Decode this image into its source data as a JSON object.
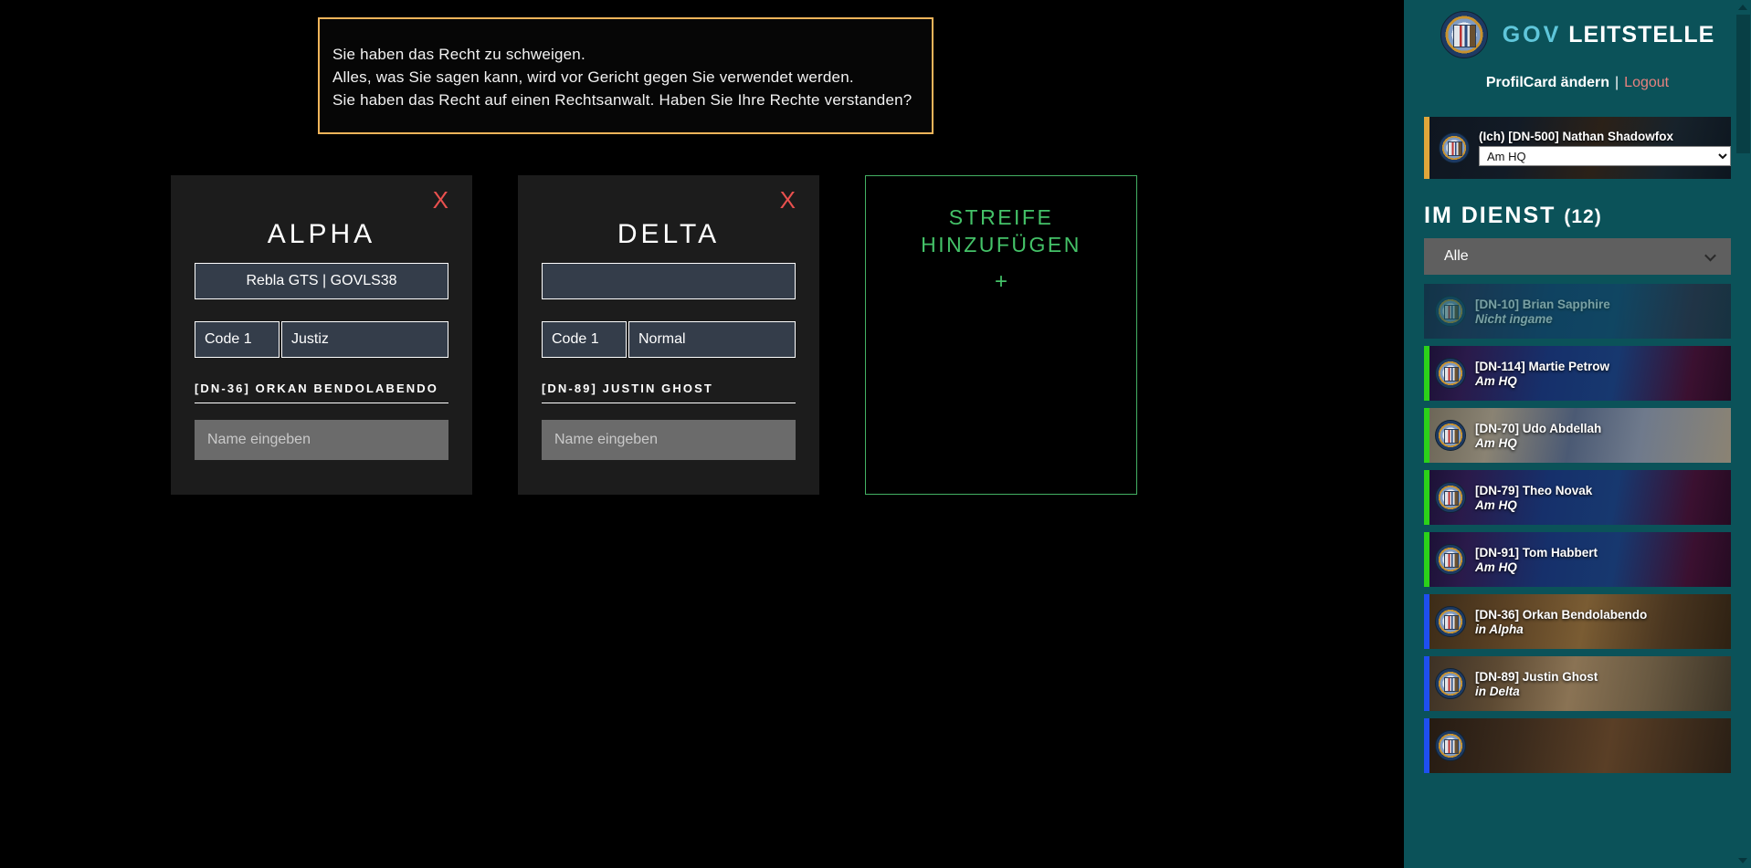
{
  "miranda": {
    "lines": [
      "Sie haben das Recht zu schweigen.",
      "Alles, was Sie sagen kann, wird vor Gericht gegen Sie verwendet werden.",
      "Sie haben das Recht auf einen Rechtsanwalt. Haben Sie Ihre Rechte verstanden?"
    ],
    "border_color": "#f0b45a"
  },
  "patrols": [
    {
      "title": "ALPHA",
      "close_label": "X",
      "vehicle_value": "Rebla GTS | GOVLS38",
      "vehicle_placeholder": "",
      "code_value": "Code 1",
      "status_value": "Justiz",
      "officer": "[DN-36] ORKAN BENDOLABENDO",
      "name_placeholder": "Name eingeben",
      "name_value": ""
    },
    {
      "title": "DELTA",
      "close_label": "X",
      "vehicle_value": "",
      "vehicle_placeholder": "",
      "code_value": "Code 1",
      "status_value": "Normal",
      "officer": "[DN-89] JUSTIN GHOST",
      "name_placeholder": "Name eingeben",
      "name_value": ""
    }
  ],
  "add_patrol": {
    "title_line1": "STREIFE",
    "title_line2": "HINZUFÜGEN",
    "plus": "+",
    "accent_color": "#43b063"
  },
  "sidebar": {
    "brand_gov": "GOV",
    "brand_leitstelle": "LEITSTELLE",
    "profile_link": "ProfilCard ändern",
    "separator": "|",
    "logout_link": "Logout",
    "self": {
      "name": "(Ich) [DN-500] Nathan Shadowfox",
      "status_value": "Am HQ",
      "status_options": [
        "Am HQ"
      ]
    },
    "duty_heading": "IM DIENST",
    "duty_count": "(12)",
    "filter_value": "Alle",
    "filter_options": [
      "Alle"
    ],
    "officers": [
      {
        "name": "[DN-10] Brian Sapphire",
        "status": "Nicht ingame",
        "state": "off",
        "bg": "bg-police",
        "dim": true
      },
      {
        "name": "[DN-114] Martie Petrow",
        "status": "Am HQ",
        "state": "green",
        "bg": "bg-police",
        "dim": false
      },
      {
        "name": "[DN-70] Udo Abdellah",
        "status": "Am HQ",
        "state": "green",
        "bg": "bg-office",
        "dim": false
      },
      {
        "name": "[DN-79] Theo Novak",
        "status": "Am HQ",
        "state": "green",
        "bg": "bg-police",
        "dim": false
      },
      {
        "name": "[DN-91] Tom Habbert",
        "status": "Am HQ",
        "state": "green",
        "bg": "bg-police",
        "dim": false
      },
      {
        "name": "[DN-36] Orkan Bendolabendo",
        "status": "in Alpha",
        "state": "blue",
        "bg": "bg-court",
        "dim": false
      },
      {
        "name": "[DN-89] Justin Ghost",
        "status": "in Delta",
        "state": "blue",
        "bg": "bg-street",
        "dim": false
      },
      {
        "name": "",
        "status": "",
        "state": "blue",
        "bg": "bg-bar",
        "dim": false
      }
    ]
  },
  "colors": {
    "sidebar_bg": "#0b5259",
    "card_bg": "#1c1c1c",
    "field_bg": "#343d4a",
    "name_input_bg": "#6b6b6b",
    "close_red": "#e8504e",
    "green_accent": "#43b063",
    "gov_cyan": "#5fc6da",
    "logout_red": "#e8827f",
    "self_bar": "#e0a63a",
    "status_green": "#2bd219",
    "status_blue": "#1e4ff0"
  }
}
